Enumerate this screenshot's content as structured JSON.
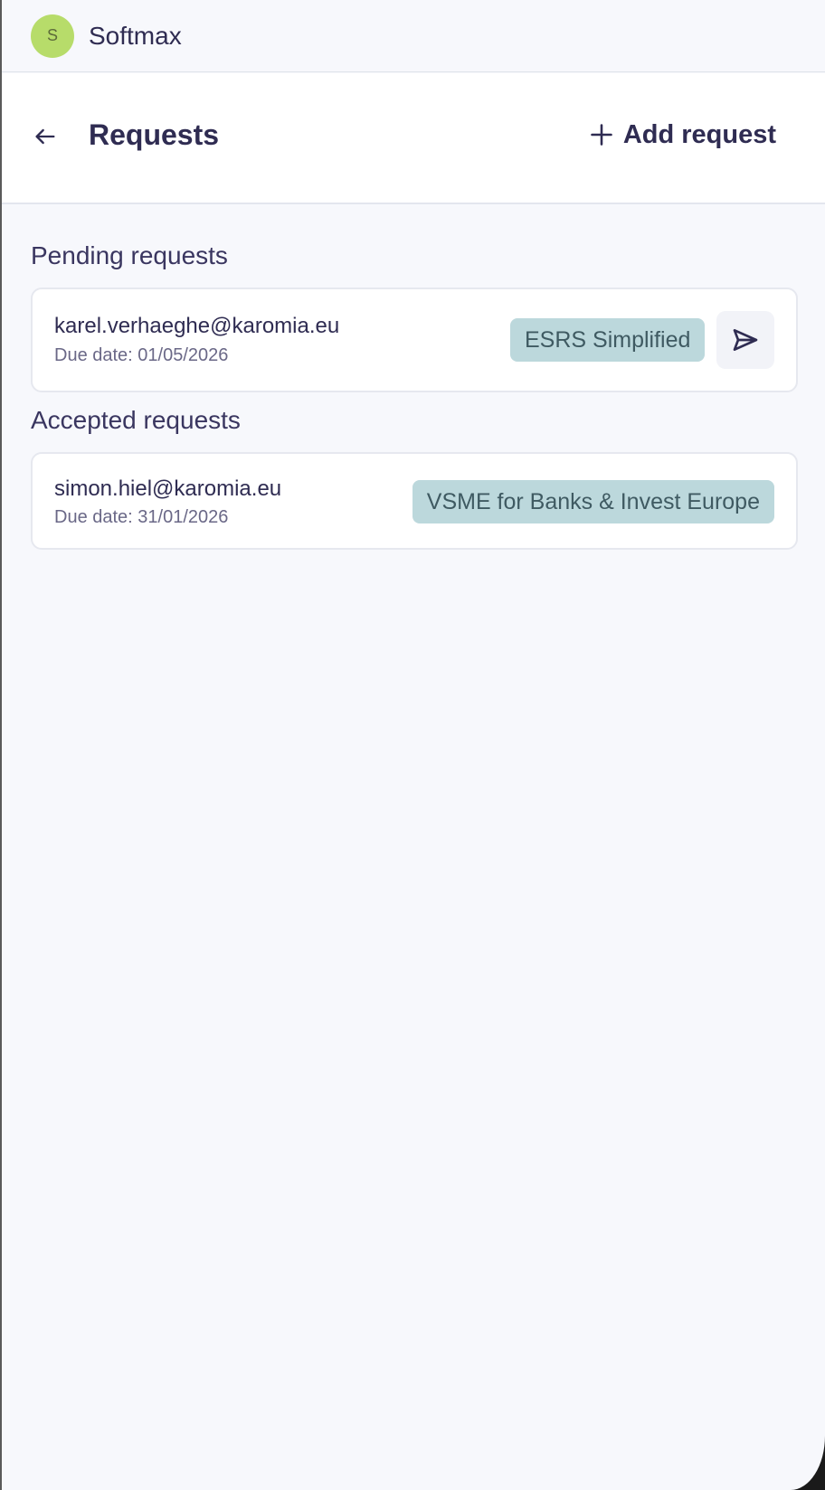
{
  "org": {
    "avatar_letter": "S",
    "name": "Softmax",
    "avatar_color": "#b7dc6a"
  },
  "header": {
    "title": "Requests",
    "add_label": "Add request"
  },
  "pending": {
    "title": "Pending requests",
    "items": [
      {
        "email": "karel.verhaeghe@karomia.eu",
        "due": "Due date: 01/05/2026",
        "tag": "ESRS Simplified"
      }
    ]
  },
  "accepted": {
    "title": "Accepted requests",
    "items": [
      {
        "email": "simon.hiel@karomia.eu",
        "due": "Due date: 31/01/2026",
        "tag": "VSME for Banks & Invest Europe"
      }
    ]
  },
  "icons": {
    "back": "arrow-left-icon",
    "add": "plus-icon",
    "send": "send-icon"
  },
  "colors": {
    "text": "#2f2c52",
    "tag_bg": "#bcd8dc",
    "background": "#f7f8fc"
  }
}
